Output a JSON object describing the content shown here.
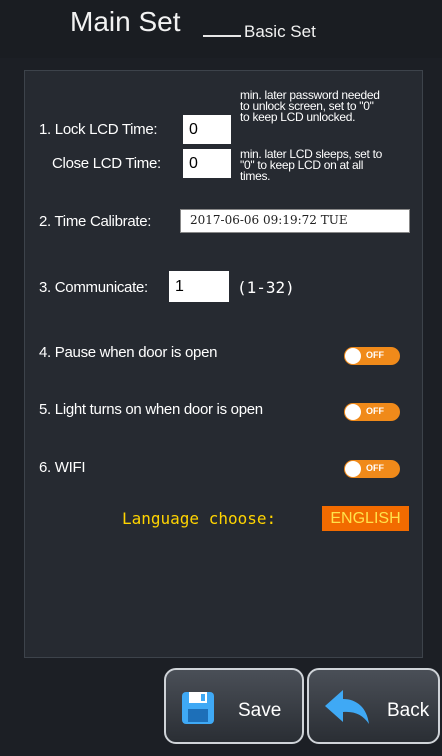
{
  "header": {
    "title": "Main Set",
    "subtitle": "Basic Set"
  },
  "settings": {
    "lock_lcd": {
      "label": "1. Lock LCD Time:",
      "value": "0",
      "note_lines": [
        "min. later password needed",
        "to unlock screen, set to \"0\"",
        "to keep LCD unlocked."
      ]
    },
    "close_lcd": {
      "label": "Close LCD Time:",
      "value": "0",
      "note_lines": [
        "min. later LCD sleeps, set to",
        "\"0\" to keep LCD on at all",
        "times."
      ]
    },
    "time_calibrate": {
      "label": "2. Time Calibrate:",
      "value": "2017-06-06 09:19:72 TUE"
    },
    "communicate": {
      "label": "3. Communicate:",
      "value": "1",
      "range": "(1-32)"
    },
    "pause_door": {
      "label": "4. Pause when door is open",
      "state": "OFF"
    },
    "light_door": {
      "label": "5. Light turns on when door is open",
      "state": "OFF"
    },
    "wifi": {
      "label": "6. WIFI",
      "state": "OFF"
    },
    "language": {
      "label": "Language choose:",
      "value": "ENGLISH"
    }
  },
  "buttons": {
    "save": "Save",
    "back": "Back"
  },
  "colors": {
    "toggle_off": "#f08a1a",
    "language_label": "#ffd400",
    "language_bg": "#f26b00"
  }
}
